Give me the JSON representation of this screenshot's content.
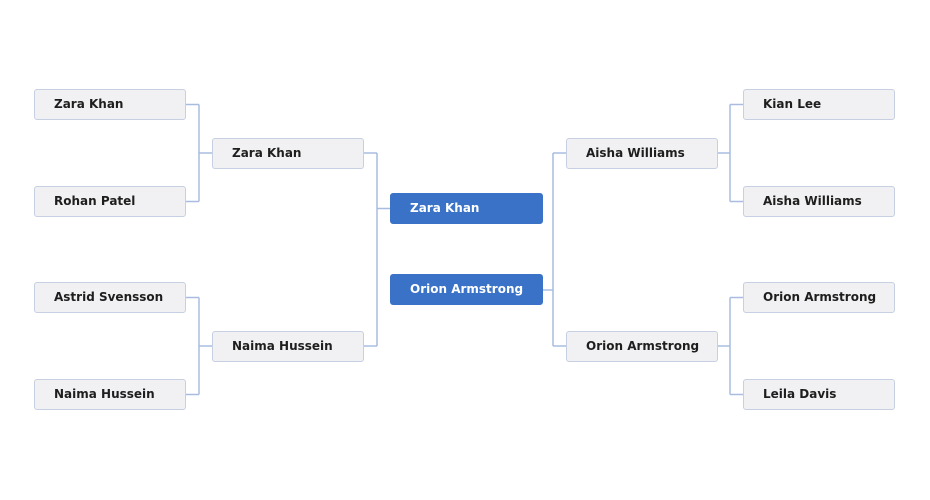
{
  "bracket": {
    "left": {
      "round1": [
        "Zara Khan",
        "Rohan Patel",
        "Astrid Svensson",
        "Naima Hussein"
      ],
      "round2": [
        "Zara Khan",
        "Naima Hussein"
      ]
    },
    "final": [
      "Zara Khan",
      "Orion Armstrong"
    ],
    "right": {
      "round2": [
        "Aisha Williams",
        "Orion Armstrong"
      ],
      "round1": [
        "Kian Lee",
        "Aisha Williams",
        "Orion Armstrong",
        "Leila Davis"
      ]
    }
  },
  "colors": {
    "final_box": "#3a72c8",
    "connector": "#a9bce0",
    "box_background": "#f1f1f3"
  }
}
